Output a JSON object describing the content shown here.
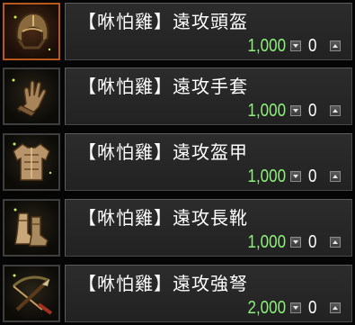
{
  "items": [
    {
      "name": "【咻怕雞】遠攻頭盔",
      "price": "1,000",
      "quantity": "0",
      "icon": "helmet-icon",
      "selected": true
    },
    {
      "name": "【咻怕雞】遠攻手套",
      "price": "1,000",
      "quantity": "0",
      "icon": "glove-icon",
      "selected": false
    },
    {
      "name": "【咻怕雞】遠攻盔甲",
      "price": "1,000",
      "quantity": "0",
      "icon": "armor-icon",
      "selected": false
    },
    {
      "name": "【咻怕雞】遠攻長靴",
      "price": "1,000",
      "quantity": "0",
      "icon": "boots-icon",
      "selected": false
    },
    {
      "name": "【咻怕雞】遠攻強弩",
      "price": "2,000",
      "quantity": "0",
      "icon": "crossbow-icon",
      "selected": false
    }
  ],
  "colors": {
    "price": "#8ef07c",
    "selected_border": "#b8581c",
    "panel_bg": "#262626"
  }
}
